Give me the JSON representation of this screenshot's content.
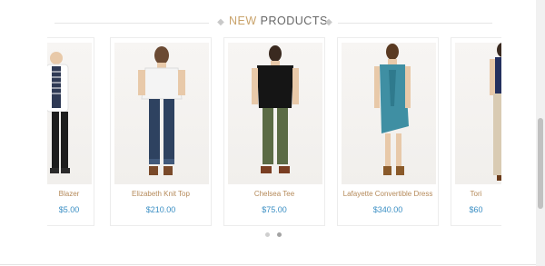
{
  "section": {
    "title_light": "NEW",
    "title_main": "PRODUCTS"
  },
  "products": [
    {
      "name": "Blazer",
      "price": "$5.00"
    },
    {
      "name": "Elizabeth Knit Top",
      "price": "$210.00"
    },
    {
      "name": "Chelsea Tee",
      "price": "$75.00"
    },
    {
      "name": "Lafayette Convertible Dress",
      "price": "$340.00"
    },
    {
      "name": "Tori",
      "price": "$60"
    }
  ],
  "carousel": {
    "pages": 2,
    "active_page": 2
  },
  "colors": {
    "accent_gold": "#c9a36b",
    "price_blue": "#3b8fc4",
    "name_brown": "#b58a5a"
  }
}
